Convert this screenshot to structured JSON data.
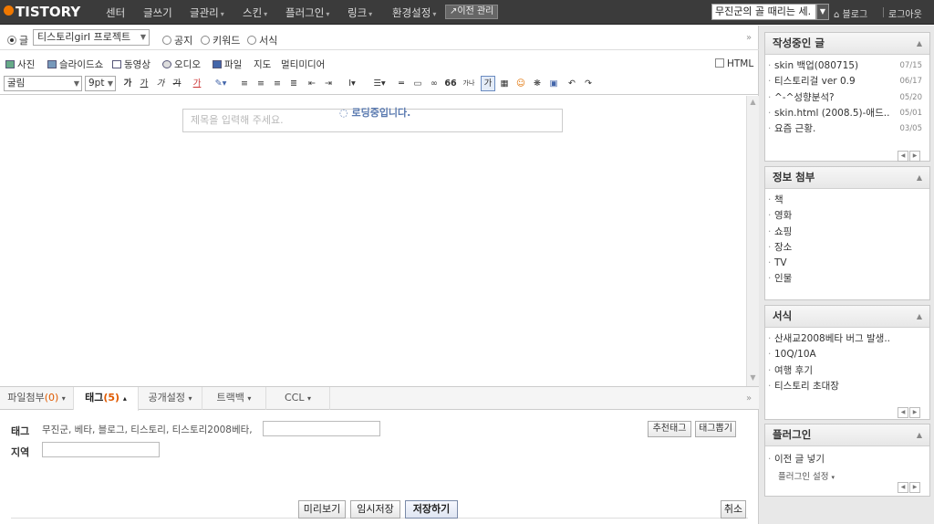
{
  "topbar": {
    "logo": "TISTORY",
    "nav": [
      "센터",
      "글쓰기",
      "글관리",
      "스킨",
      "플러그인",
      "링크",
      "환경설정"
    ],
    "prev_admin": "이전 관리",
    "blog_select": "무진군의 골 때리는 세.",
    "blog_link": "블로그",
    "logout": "로그아웃"
  },
  "post_type": {
    "post_label": "글",
    "category": "티스토리girl 프로젝트",
    "notice_label": "공지",
    "keyword_label": "키워드",
    "form_label": "서식"
  },
  "media": {
    "photo": "사진",
    "slideshow": "슬라이드쇼",
    "video": "동영상",
    "audio": "오디오",
    "file": "파일",
    "map": "지도",
    "multimedia": "멀티미디어",
    "html_label": "HTML"
  },
  "format": {
    "font": "굴림",
    "size": "9pt",
    "bold": "가",
    "underline": "가",
    "italic": "가",
    "strike": "가",
    "color": "가",
    "quote": "66",
    "special": "가나"
  },
  "editor": {
    "title_placeholder": "제목을 입력해 주세요.",
    "loading": "로딩중입니다."
  },
  "bottom_tabs": {
    "attach": "파일첨부",
    "attach_count": "(0)",
    "tag": "태그",
    "tag_count": "(5)",
    "visibility": "공개설정",
    "trackback": "트랙백",
    "ccl": "CCL"
  },
  "tags": {
    "label": "태그",
    "values": "무진군, 베타, 블로그, 티스토리, 티스토리2008베타,",
    "region_label": "지역",
    "recommend_btn": "추천태그",
    "fetch_btn": "태그뽑기"
  },
  "actions": {
    "preview": "미리보기",
    "draft": "임시저장",
    "save": "저장하기",
    "cancel": "취소"
  },
  "sidebar": {
    "writing": {
      "title": "작성중인 글",
      "items": [
        {
          "title": "skin 백업(080715)",
          "date": "07/15"
        },
        {
          "title": "티스토리걸 ver 0.9",
          "date": "06/17"
        },
        {
          "title": "^-^성향분석?",
          "date": "05/20"
        },
        {
          "title": "skin.html (2008.5)-애드..",
          "date": "05/01"
        },
        {
          "title": "요즘 근황.",
          "date": "03/05"
        }
      ]
    },
    "info": {
      "title": "정보 첨부",
      "items": [
        "책",
        "영화",
        "쇼핑",
        "장소",
        "TV",
        "인물"
      ]
    },
    "forms": {
      "title": "서식",
      "items": [
        "산새교2008베타 버그 발생..",
        "10Q/10A",
        "여행 후기",
        "티스토리 초대장"
      ]
    },
    "plugins": {
      "title": "플러그인",
      "items": [
        "이전 글 넣기"
      ],
      "setting": "플러그인 설정"
    }
  }
}
